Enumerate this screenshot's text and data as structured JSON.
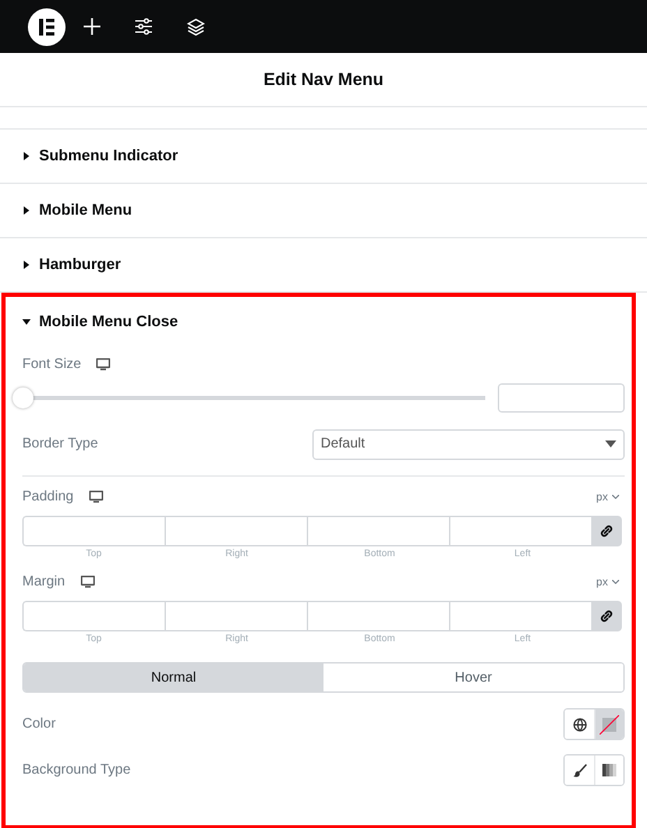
{
  "header": {
    "title": "Edit Nav Menu"
  },
  "sections": [
    {
      "title": "Submenu Indicator",
      "expanded": false,
      "highlighted": false
    },
    {
      "title": "Mobile Menu",
      "expanded": false,
      "highlighted": false
    },
    {
      "title": "Hamburger",
      "expanded": false,
      "highlighted": false
    },
    {
      "title": "Mobile Menu Close",
      "expanded": true,
      "highlighted": true,
      "controls": [
        {
          "kind": "slider",
          "label": "Font Size",
          "responsive": true,
          "level": 0
        },
        {
          "kind": "select",
          "label": "Border Type",
          "value": "Default"
        },
        {
          "kind": "divider"
        },
        {
          "kind": "dimensions",
          "label": "Padding",
          "responsive": true,
          "unit": "px",
          "fields": [
            "Top",
            "Right",
            "Bottom",
            "Left"
          ]
        },
        {
          "kind": "dimensions",
          "label": "Margin",
          "responsive": true,
          "unit": "px",
          "fields": [
            "Top",
            "Right",
            "Bottom",
            "Left"
          ]
        },
        {
          "kind": "tabs",
          "tabs": [
            {
              "label": "Normal",
              "selected": true
            },
            {
              "label": "Hover",
              "selected": false
            }
          ]
        },
        {
          "kind": "color",
          "label": "Color"
        },
        {
          "kind": "choose",
          "label": "Background Type"
        }
      ]
    }
  ]
}
